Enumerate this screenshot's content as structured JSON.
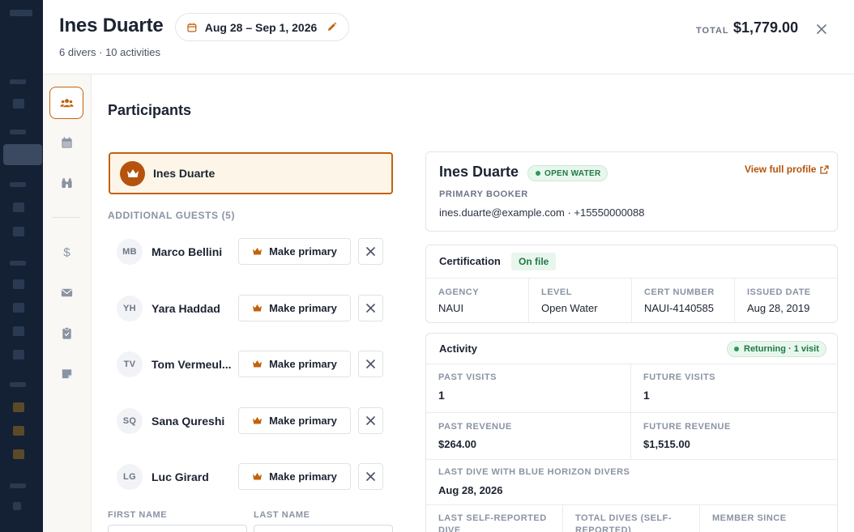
{
  "header": {
    "name": "Ines Duarte",
    "date_range": "Aug 28 – Sep 1, 2026",
    "subtitle": "6 divers · 10 activities",
    "total_label": "TOTAL",
    "total_value": "$1,779.00"
  },
  "rail": {
    "items": [
      "participants-icon",
      "calendar-icon",
      "binoculars-icon",
      "dollar-icon",
      "envelope-icon",
      "clipboard-icon",
      "note-icon"
    ],
    "active": "participants-icon"
  },
  "participants": {
    "title": "Participants",
    "primary_name": "Ines Duarte",
    "additional_label": "ADDITIONAL GUESTS (5)",
    "make_primary_label": "Make primary",
    "guests": [
      {
        "initials": "MB",
        "name": "Marco Bellini"
      },
      {
        "initials": "YH",
        "name": "Yara Haddad"
      },
      {
        "initials": "TV",
        "name": "Tom Vermeul..."
      },
      {
        "initials": "SQ",
        "name": "Sana Qureshi"
      },
      {
        "initials": "LG",
        "name": "Luc Girard"
      }
    ],
    "first_name_label": "FIRST NAME",
    "last_name_label": "LAST NAME"
  },
  "profile": {
    "name": "Ines Duarte",
    "badge": "OPEN WATER",
    "role": "PRIMARY BOOKER",
    "contact": "ines.duarte@example.com · +15550000088",
    "view_profile": "View full profile"
  },
  "certification": {
    "title": "Certification",
    "status": "On file",
    "agency_label": "AGENCY",
    "agency": "NAUI",
    "level_label": "LEVEL",
    "level": "Open Water",
    "cert_number_label": "CERT NUMBER",
    "cert_number": "NAUI-4140585",
    "issued_label": "ISSUED DATE",
    "issued": "Aug 28, 2019"
  },
  "activity": {
    "title": "Activity",
    "returning_badge": "Returning · 1 visit",
    "past_visits_label": "PAST VISITS",
    "past_visits": "1",
    "future_visits_label": "FUTURE VISITS",
    "future_visits": "1",
    "past_revenue_label": "PAST REVENUE",
    "past_revenue": "$264.00",
    "future_revenue_label": "FUTURE REVENUE",
    "future_revenue": "$1,515.00",
    "last_dive_label": "LAST DIVE WITH BLUE HORIZON DIVERS",
    "last_dive": "Aug 28, 2026",
    "last_self_reported_label": "LAST SELF-REPORTED DIVE",
    "total_dives_label": "TOTAL DIVES (SELF-REPORTED)",
    "member_since_label": "MEMBER SINCE"
  },
  "colors": {
    "accent": "#c2620c",
    "accent_dark": "#b5530c",
    "success": "#1d7a44",
    "text": "#1c2331"
  }
}
